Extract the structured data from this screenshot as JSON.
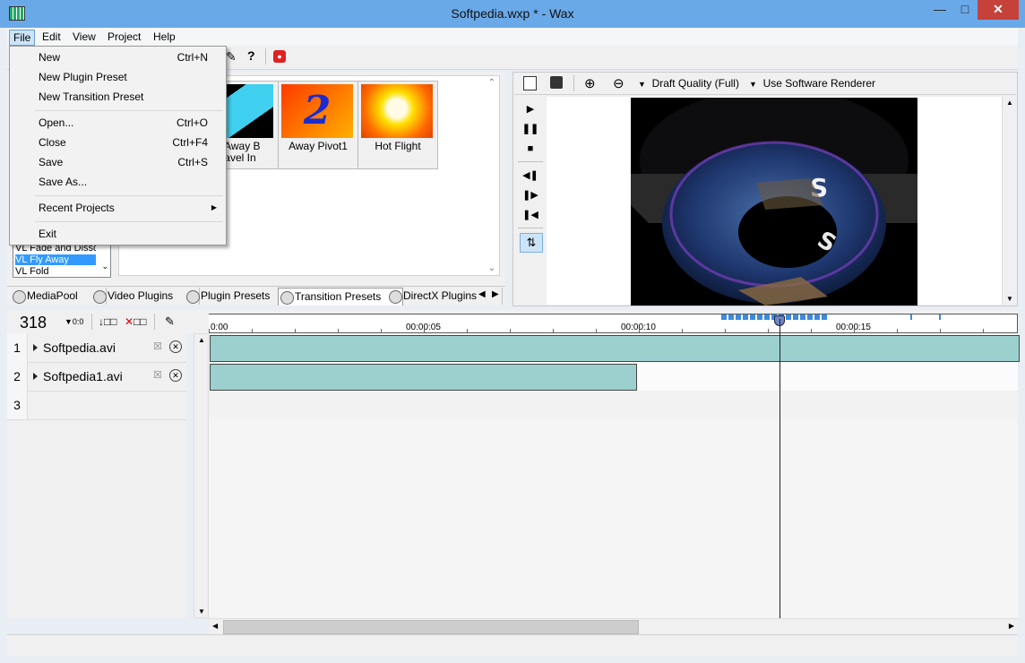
{
  "window": {
    "title": "Softpedia.wxp * - Wax"
  },
  "menubar": [
    "File",
    "Edit",
    "View",
    "Project",
    "Help"
  ],
  "file_menu": {
    "new": {
      "label": "New",
      "shortcut": "Ctrl+N"
    },
    "new_plugin_preset": {
      "label": "New Plugin Preset"
    },
    "new_transition_preset": {
      "label": "New Transition Preset"
    },
    "open": {
      "label": "Open...",
      "shortcut": "Ctrl+O"
    },
    "close": {
      "label": "Close",
      "shortcut": "Ctrl+F4"
    },
    "save": {
      "label": "Save",
      "shortcut": "Ctrl+S"
    },
    "save_as": {
      "label": "Save As..."
    },
    "recent": {
      "label": "Recent Projects"
    },
    "exit": {
      "label": "Exit"
    }
  },
  "presets": {
    "list": [
      "VL Fade and Disso",
      "VL Fly Away",
      "VL Fold"
    ],
    "selected_index": 1,
    "thumbs": [
      {
        "label": "y Away B\nravel In",
        "icon": "cyan-shape-thumb"
      },
      {
        "label": "Away Pivot1",
        "icon": "number-2-thumb"
      },
      {
        "label": "Hot Flight",
        "icon": "fire-thumb"
      }
    ]
  },
  "tabs": [
    "MediaPool",
    "Video Plugins",
    "Plugin Presets",
    "Transition Presets",
    "DirectX Plugins"
  ],
  "active_tab": 3,
  "preview": {
    "quality": "Draft Quality (Full)",
    "renderer": "Use Software Renderer"
  },
  "timeline": {
    "frame": "318",
    "zoom_label": "0:0",
    "ruler": [
      "0:00",
      "00:00:05",
      "00:00:10",
      "00:00:15"
    ],
    "tracks": [
      {
        "num": "1",
        "name": "Softpedia.avi"
      },
      {
        "num": "2",
        "name": "Softpedia1.avi"
      },
      {
        "num": "3",
        "name": ""
      }
    ]
  },
  "colors": {
    "titlebar": "#6aa9e8",
    "clip": "#9cd0cf",
    "selection": "#3399ff"
  }
}
